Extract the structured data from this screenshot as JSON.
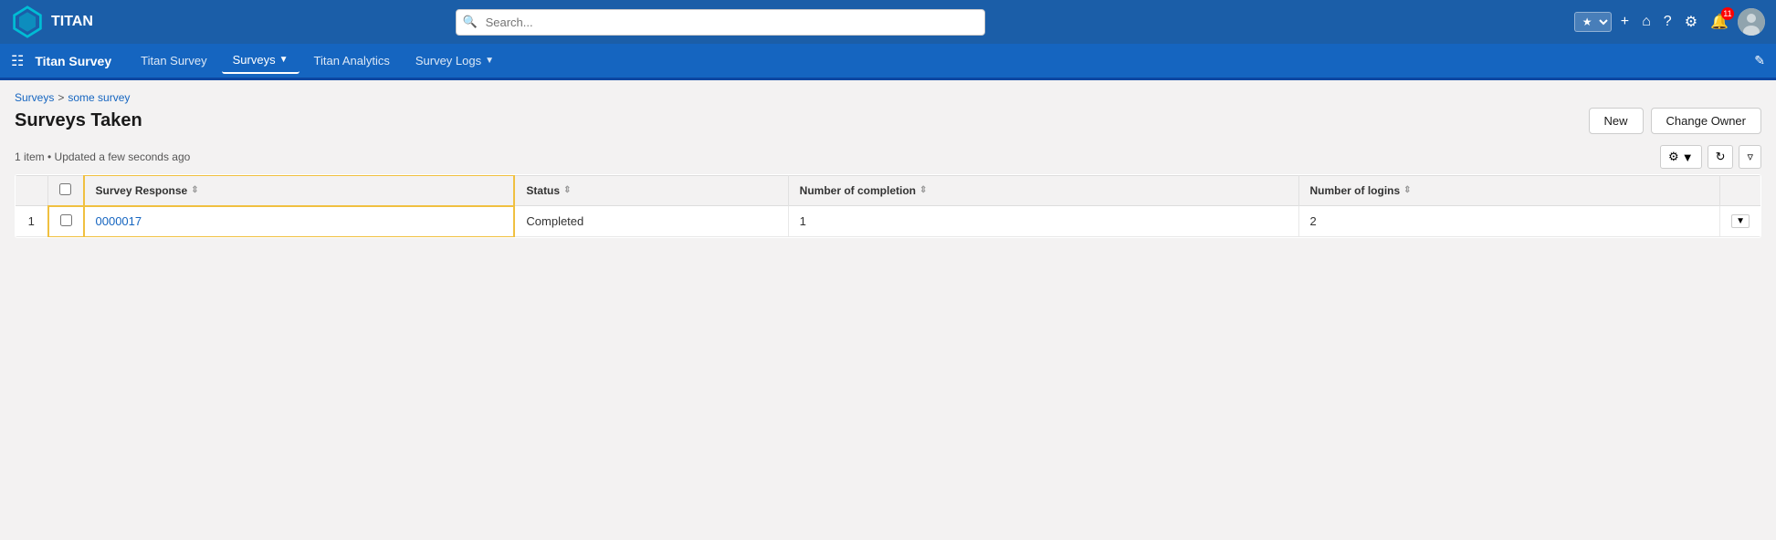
{
  "app": {
    "name": "Titan Survey",
    "logo_text": "TITAN"
  },
  "topnav": {
    "search_placeholder": "Search...",
    "notification_count": "11"
  },
  "appbar": {
    "app_name": "Titan Survey",
    "nav_items": [
      {
        "label": "Titan Survey",
        "active": false,
        "has_dropdown": false
      },
      {
        "label": "Surveys",
        "active": true,
        "has_dropdown": true
      },
      {
        "label": "Titan Analytics",
        "active": false,
        "has_dropdown": false
      },
      {
        "label": "Survey Logs",
        "active": false,
        "has_dropdown": true
      }
    ]
  },
  "breadcrumb": {
    "parent": "Surveys",
    "separator": ">",
    "child": "some survey"
  },
  "page": {
    "title": "Surveys Taken",
    "record_info": "1 item • Updated a few seconds ago",
    "buttons": {
      "new": "New",
      "change_owner": "Change Owner"
    }
  },
  "table": {
    "columns": [
      {
        "key": "survey_response",
        "label": "Survey Response",
        "sortable": true
      },
      {
        "key": "status",
        "label": "Status",
        "sortable": true
      },
      {
        "key": "number_of_completion",
        "label": "Number of completion",
        "sortable": true
      },
      {
        "key": "number_of_logins",
        "label": "Number of logins",
        "sortable": true
      }
    ],
    "rows": [
      {
        "num": "1",
        "survey_response": "0000017",
        "status": "Completed",
        "number_of_completion": "1",
        "number_of_logins": "2"
      }
    ]
  }
}
